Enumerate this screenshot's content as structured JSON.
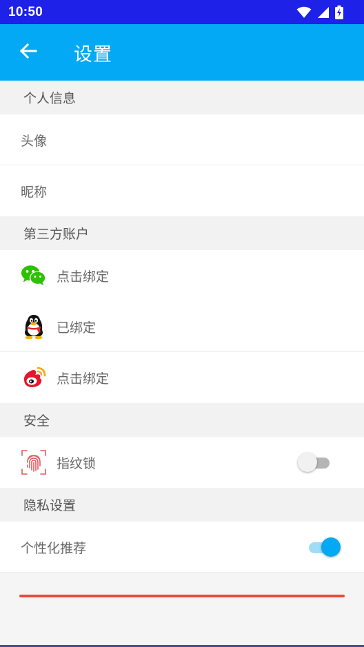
{
  "status_bar": {
    "time": "10:50",
    "icons": [
      "wifi-icon",
      "cellular-signal-icon",
      "battery-charging-icon"
    ]
  },
  "app_bar": {
    "back_icon": "arrow-left-icon",
    "title": "设置"
  },
  "sections": {
    "personal": {
      "header": "个人信息",
      "avatar_label": "头像",
      "nickname_label": "昵称"
    },
    "third_party": {
      "header": "第三方账户",
      "wechat": {
        "icon": "wechat-icon",
        "label": "点击绑定"
      },
      "qq": {
        "icon": "qq-penguin-icon",
        "label": "已绑定"
      },
      "weibo": {
        "icon": "weibo-icon",
        "label": "点击绑定"
      }
    },
    "security": {
      "header": "安全",
      "fingerprint": {
        "icon": "fingerprint-icon",
        "label": "指纹锁",
        "enabled": false
      }
    },
    "privacy": {
      "header": "隐私设置",
      "personalized": {
        "label": "个性化推荐",
        "enabled": true
      }
    }
  },
  "colors": {
    "status_bar": "#1e21e8",
    "app_bar": "#03a9f4",
    "switch_on": "#03a9f4",
    "accent_line": "#e94b3c",
    "wechat": "#2dc100",
    "weibo": "#e6162d"
  }
}
